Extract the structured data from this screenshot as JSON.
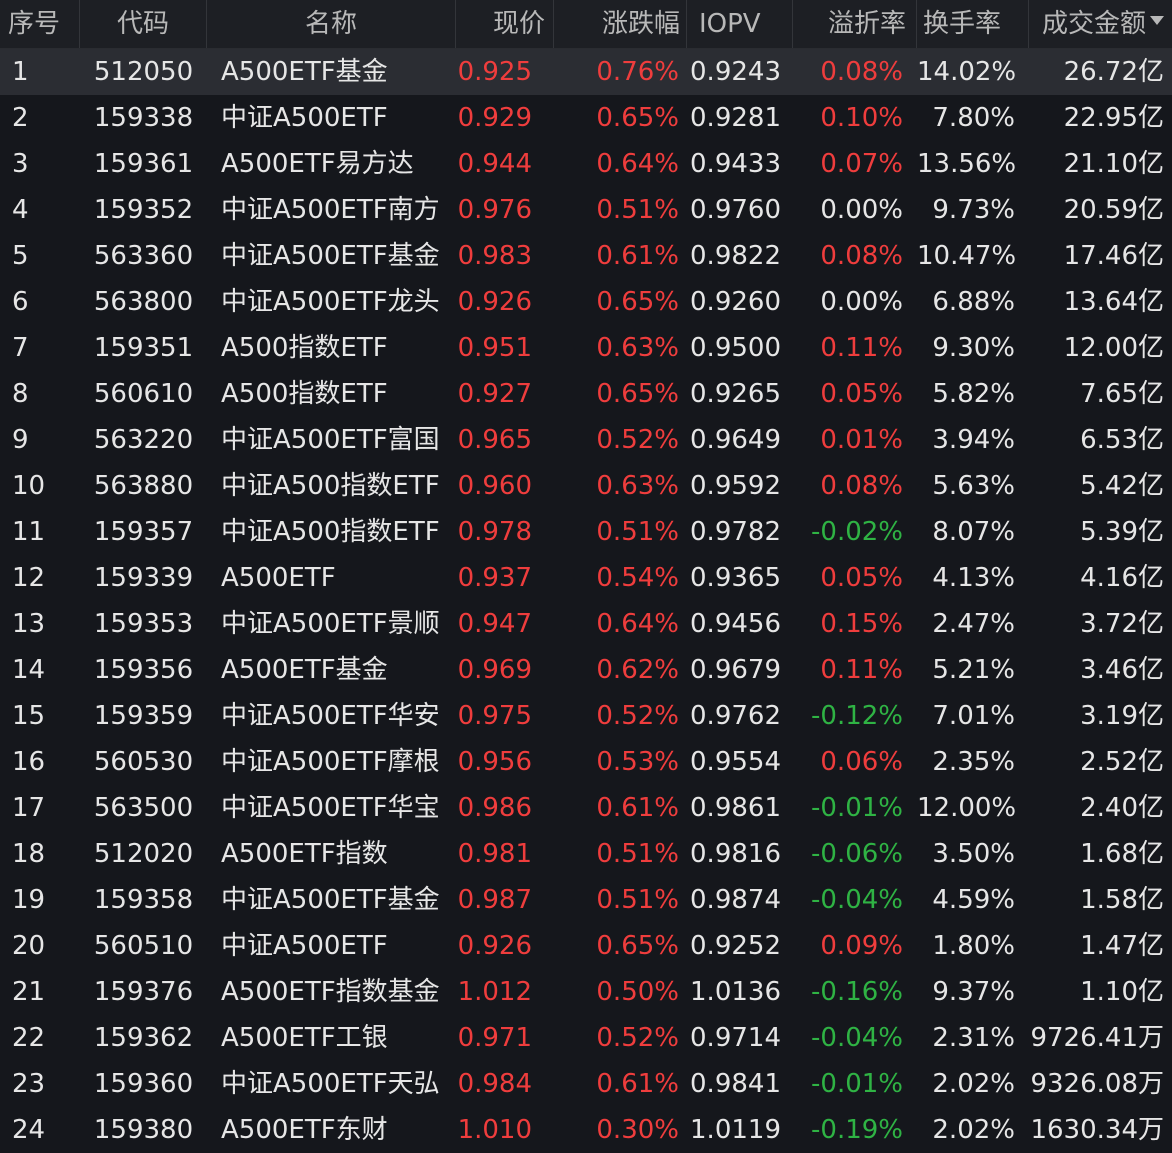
{
  "colors": {
    "up": "#ef3d3d",
    "down": "#2fb344",
    "flat": "#e6e6e6",
    "background": "#15171c",
    "header_bg": "#1d1f24",
    "selected_row": "#2b2d33"
  },
  "header": {
    "seq": "序号",
    "code": "代码",
    "name": "名称",
    "price": "现价",
    "change": "涨跌幅",
    "iopv": "IOPV",
    "premium": "溢折率",
    "turnover": "换手率",
    "amount": "成交金额",
    "sort_icon": "sort-desc-icon"
  },
  "rows": [
    {
      "seq": "1",
      "code": "512050",
      "name": "A500ETF基金",
      "price": "0.925",
      "change": "0.76%",
      "iopv": "0.9243",
      "premium": "0.08%",
      "premium_dir": "up",
      "turnover": "14.02%",
      "amount": "26.72亿"
    },
    {
      "seq": "2",
      "code": "159338",
      "name": "中证A500ETF",
      "price": "0.929",
      "change": "0.65%",
      "iopv": "0.9281",
      "premium": "0.10%",
      "premium_dir": "up",
      "turnover": "7.80%",
      "amount": "22.95亿"
    },
    {
      "seq": "3",
      "code": "159361",
      "name": "A500ETF易方达",
      "price": "0.944",
      "change": "0.64%",
      "iopv": "0.9433",
      "premium": "0.07%",
      "premium_dir": "up",
      "turnover": "13.56%",
      "amount": "21.10亿"
    },
    {
      "seq": "4",
      "code": "159352",
      "name": "中证A500ETF南方",
      "price": "0.976",
      "change": "0.51%",
      "iopv": "0.9760",
      "premium": "0.00%",
      "premium_dir": "flat",
      "turnover": "9.73%",
      "amount": "20.59亿"
    },
    {
      "seq": "5",
      "code": "563360",
      "name": "中证A500ETF基金",
      "price": "0.983",
      "change": "0.61%",
      "iopv": "0.9822",
      "premium": "0.08%",
      "premium_dir": "up",
      "turnover": "10.47%",
      "amount": "17.46亿"
    },
    {
      "seq": "6",
      "code": "563800",
      "name": "中证A500ETF龙头",
      "price": "0.926",
      "change": "0.65%",
      "iopv": "0.9260",
      "premium": "0.00%",
      "premium_dir": "flat",
      "turnover": "6.88%",
      "amount": "13.64亿"
    },
    {
      "seq": "7",
      "code": "159351",
      "name": "A500指数ETF",
      "price": "0.951",
      "change": "0.63%",
      "iopv": "0.9500",
      "premium": "0.11%",
      "premium_dir": "up",
      "turnover": "9.30%",
      "amount": "12.00亿"
    },
    {
      "seq": "8",
      "code": "560610",
      "name": "A500指数ETF",
      "price": "0.927",
      "change": "0.65%",
      "iopv": "0.9265",
      "premium": "0.05%",
      "premium_dir": "up",
      "turnover": "5.82%",
      "amount": "7.65亿"
    },
    {
      "seq": "9",
      "code": "563220",
      "name": "中证A500ETF富国",
      "price": "0.965",
      "change": "0.52%",
      "iopv": "0.9649",
      "premium": "0.01%",
      "premium_dir": "up",
      "turnover": "3.94%",
      "amount": "6.53亿"
    },
    {
      "seq": "10",
      "code": "563880",
      "name": "中证A500指数ETF",
      "price": "0.960",
      "change": "0.63%",
      "iopv": "0.9592",
      "premium": "0.08%",
      "premium_dir": "up",
      "turnover": "5.63%",
      "amount": "5.42亿"
    },
    {
      "seq": "11",
      "code": "159357",
      "name": "中证A500指数ETF",
      "price": "0.978",
      "change": "0.51%",
      "iopv": "0.9782",
      "premium": "-0.02%",
      "premium_dir": "down",
      "turnover": "8.07%",
      "amount": "5.39亿"
    },
    {
      "seq": "12",
      "code": "159339",
      "name": "A500ETF",
      "price": "0.937",
      "change": "0.54%",
      "iopv": "0.9365",
      "premium": "0.05%",
      "premium_dir": "up",
      "turnover": "4.13%",
      "amount": "4.16亿"
    },
    {
      "seq": "13",
      "code": "159353",
      "name": "中证A500ETF景顺",
      "price": "0.947",
      "change": "0.64%",
      "iopv": "0.9456",
      "premium": "0.15%",
      "premium_dir": "up",
      "turnover": "2.47%",
      "amount": "3.72亿"
    },
    {
      "seq": "14",
      "code": "159356",
      "name": "A500ETF基金",
      "price": "0.969",
      "change": "0.62%",
      "iopv": "0.9679",
      "premium": "0.11%",
      "premium_dir": "up",
      "turnover": "5.21%",
      "amount": "3.46亿"
    },
    {
      "seq": "15",
      "code": "159359",
      "name": "中证A500ETF华安",
      "price": "0.975",
      "change": "0.52%",
      "iopv": "0.9762",
      "premium": "-0.12%",
      "premium_dir": "down",
      "turnover": "7.01%",
      "amount": "3.19亿"
    },
    {
      "seq": "16",
      "code": "560530",
      "name": "中证A500ETF摩根",
      "price": "0.956",
      "change": "0.53%",
      "iopv": "0.9554",
      "premium": "0.06%",
      "premium_dir": "up",
      "turnover": "2.35%",
      "amount": "2.52亿"
    },
    {
      "seq": "17",
      "code": "563500",
      "name": "中证A500ETF华宝",
      "price": "0.986",
      "change": "0.61%",
      "iopv": "0.9861",
      "premium": "-0.01%",
      "premium_dir": "down",
      "turnover": "12.00%",
      "amount": "2.40亿"
    },
    {
      "seq": "18",
      "code": "512020",
      "name": "A500ETF指数",
      "price": "0.981",
      "change": "0.51%",
      "iopv": "0.9816",
      "premium": "-0.06%",
      "premium_dir": "down",
      "turnover": "3.50%",
      "amount": "1.68亿"
    },
    {
      "seq": "19",
      "code": "159358",
      "name": "中证A500ETF基金",
      "price": "0.987",
      "change": "0.51%",
      "iopv": "0.9874",
      "premium": "-0.04%",
      "premium_dir": "down",
      "turnover": "4.59%",
      "amount": "1.58亿"
    },
    {
      "seq": "20",
      "code": "560510",
      "name": "中证A500ETF",
      "price": "0.926",
      "change": "0.65%",
      "iopv": "0.9252",
      "premium": "0.09%",
      "premium_dir": "up",
      "turnover": "1.80%",
      "amount": "1.47亿"
    },
    {
      "seq": "21",
      "code": "159376",
      "name": "A500ETF指数基金",
      "price": "1.012",
      "change": "0.50%",
      "iopv": "1.0136",
      "premium": "-0.16%",
      "premium_dir": "down",
      "turnover": "9.37%",
      "amount": "1.10亿"
    },
    {
      "seq": "22",
      "code": "159362",
      "name": "A500ETF工银",
      "price": "0.971",
      "change": "0.52%",
      "iopv": "0.9714",
      "premium": "-0.04%",
      "premium_dir": "down",
      "turnover": "2.31%",
      "amount": "9726.41万"
    },
    {
      "seq": "23",
      "code": "159360",
      "name": "中证A500ETF天弘",
      "price": "0.984",
      "change": "0.61%",
      "iopv": "0.9841",
      "premium": "-0.01%",
      "premium_dir": "down",
      "turnover": "2.02%",
      "amount": "9326.08万"
    },
    {
      "seq": "24",
      "code": "159380",
      "name": "A500ETF东财",
      "price": "1.010",
      "change": "0.30%",
      "iopv": "1.0119",
      "premium": "-0.19%",
      "premium_dir": "down",
      "turnover": "2.02%",
      "amount": "1630.34万"
    }
  ]
}
